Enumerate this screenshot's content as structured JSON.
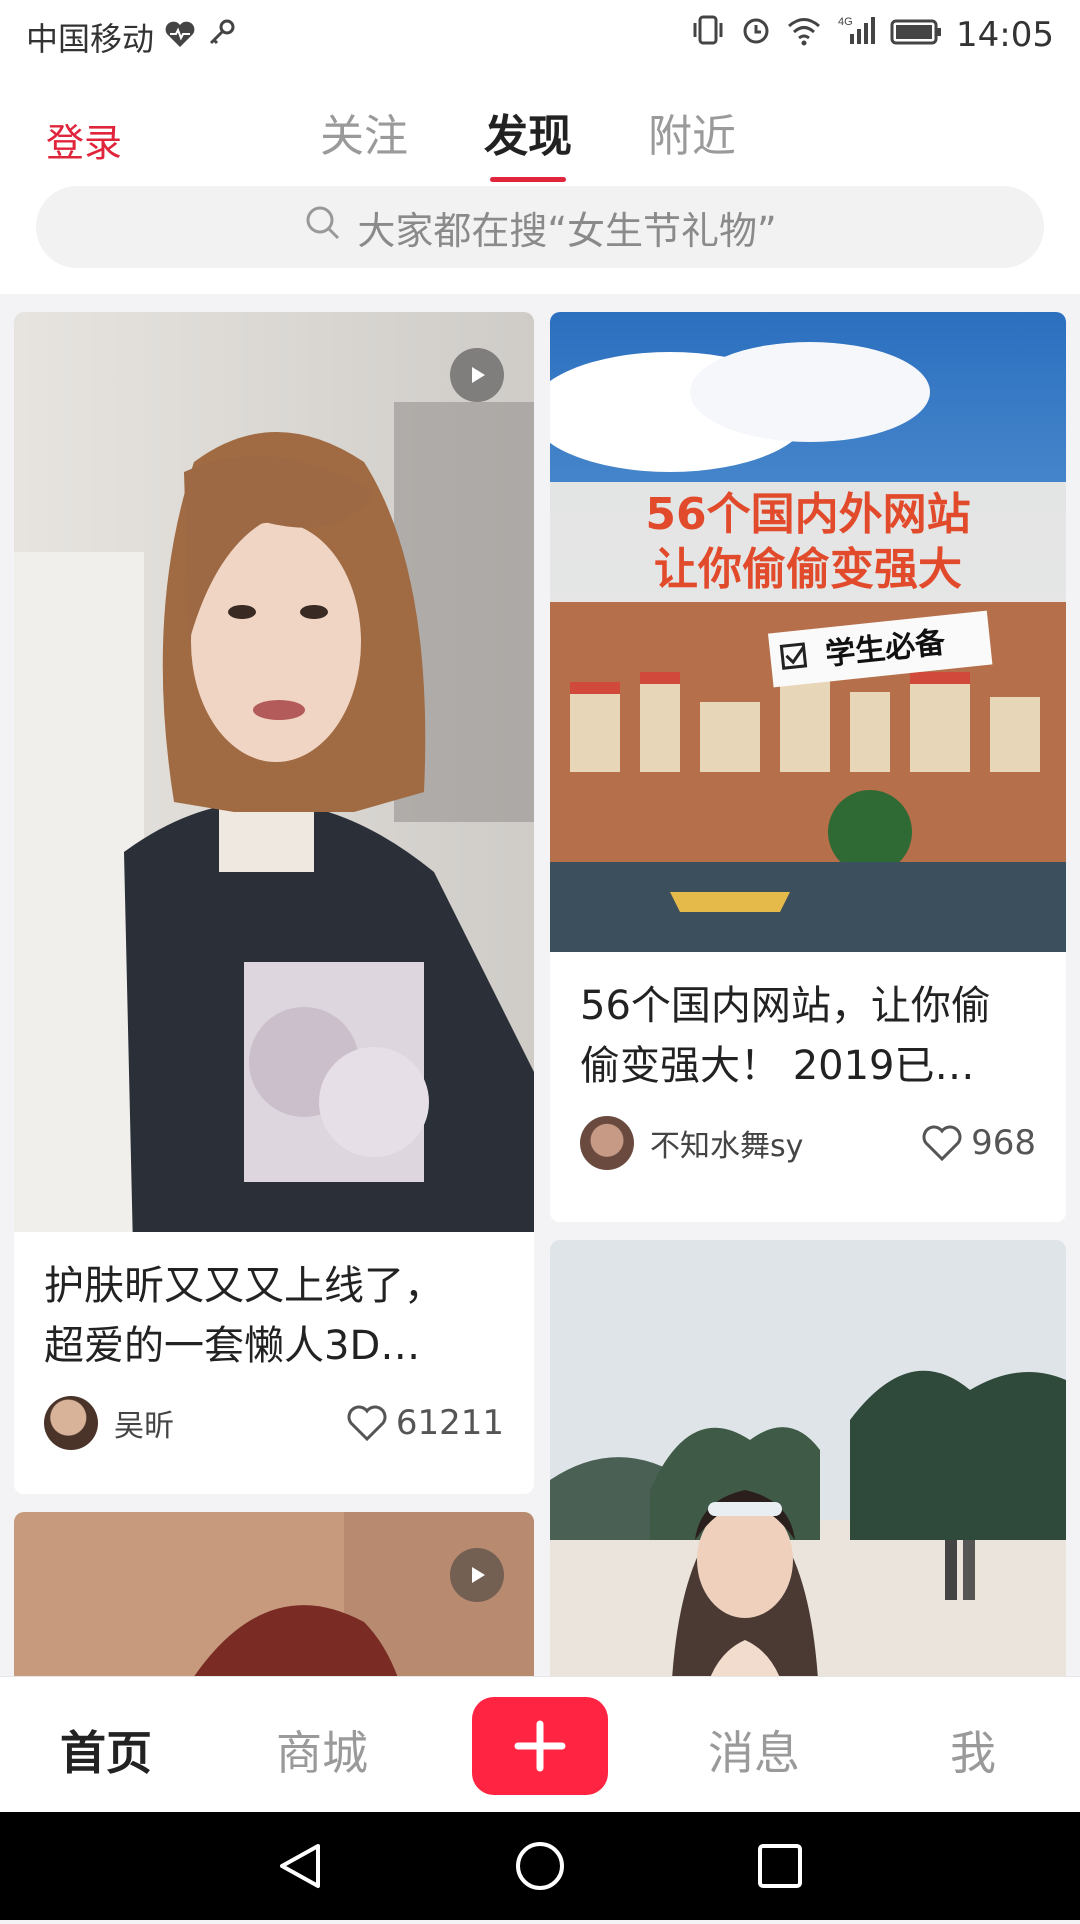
{
  "status_bar": {
    "carrier": "中国移动",
    "time": "14:05",
    "network": "4G"
  },
  "header": {
    "login_label": "登录",
    "tabs": [
      {
        "label": "关注",
        "active": false
      },
      {
        "label": "发现",
        "active": true
      },
      {
        "label": "附近",
        "active": false
      }
    ],
    "search_placeholder": "大家都在搜“女生节礼物”"
  },
  "feed": {
    "cards": [
      {
        "title_line1": "护肤昕又又又上线了，",
        "title_line2": "超爱的一套懒人3D…",
        "author": "吴昕",
        "likes": "61211",
        "is_video": true
      },
      {
        "cover_headline_line1": "56个国内外网站",
        "cover_headline_line2": "让你偷偷变强大",
        "cover_tag": "学生必备",
        "title_line1": "56个国内网站，让你偷",
        "title_line2": "偷变强大！ 2019已…",
        "author": "不知水舞sy",
        "likes": "968",
        "is_video": false
      },
      {
        "is_video": true
      },
      {
        "is_video": false
      }
    ]
  },
  "bottom_nav": {
    "items": [
      "首页",
      "商城",
      "消息",
      "我"
    ],
    "active": "首页"
  },
  "colors": {
    "accent": "#ff2442",
    "active_tab_underline": "#e0243c"
  }
}
